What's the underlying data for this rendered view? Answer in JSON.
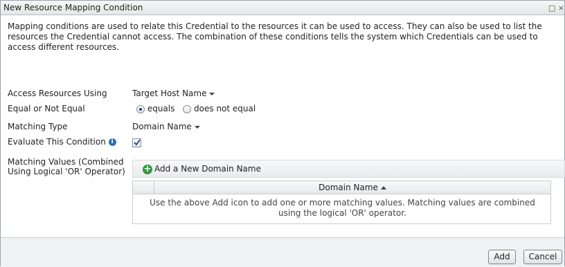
{
  "dialog": {
    "title": "New Resource Mapping Condition",
    "maximize_glyph": "□",
    "close_glyph": "×"
  },
  "description": "Mapping conditions are used to relate this Credential to the resources it can be used to access. They can also be used to list the resources the Credential cannot access. The combination of these conditions tells the system which Credentials can be used to access different resources.",
  "form": {
    "access_label": "Access Resources Using",
    "access_value": "Target Host Name",
    "equal_label": "Equal or Not Equal",
    "equals_option": "equals",
    "not_equal_option": "does not equal",
    "equals_selected": true,
    "matching_type_label": "Matching Type",
    "matching_type_value": "Domain Name",
    "evaluate_label": "Evaluate This Condition",
    "evaluate_checked": true,
    "matching_values_label": "Matching Values (Combined Using Logical 'OR' Operator)"
  },
  "values_panel": {
    "add_label": "Add a New Domain Name",
    "column_header": "Domain Name",
    "empty_message": "Use the above Add icon to add one or more matching values. Matching values are combined using the logical 'OR' operator."
  },
  "footer": {
    "add_button": "Add",
    "cancel_button": "Cancel"
  },
  "icons": {
    "dropdown": "caret-down-icon",
    "info": "info-icon",
    "add": "plus-circle-icon",
    "sort": "sort-ascending-icon"
  },
  "colors": {
    "info_blue": "#2f6fb3",
    "add_green": "#2e9a3a"
  }
}
